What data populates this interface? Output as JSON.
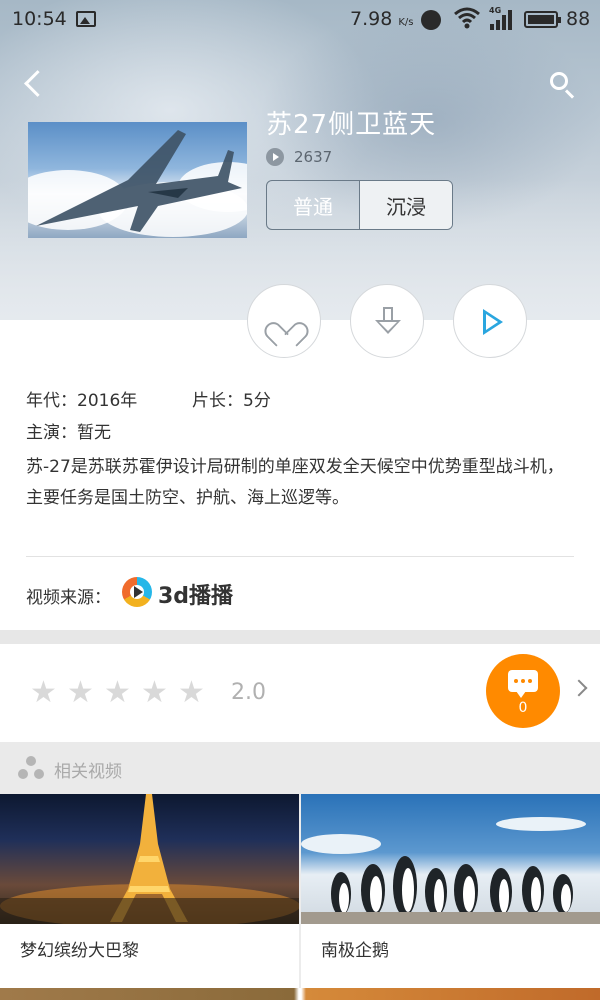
{
  "status_bar": {
    "time": "10:54",
    "net_speed": "7.98",
    "net_speed_unit": "K/s",
    "network_type": "4G",
    "battery": "88"
  },
  "header": {
    "back_icon": "chevron-left-icon",
    "search_icon": "search-icon"
  },
  "video": {
    "title": "苏27侧卫蓝天",
    "play_count": "2637",
    "modes": [
      "普通",
      "沉浸"
    ],
    "selected_mode": "沉浸"
  },
  "actions": {
    "like_icon": "heart-icon",
    "download_icon": "download-icon",
    "play_icon": "play-icon",
    "play_color": "#2aa6df"
  },
  "info": {
    "year": "年代：2016年",
    "duration": "片长：5分",
    "cast": "主演：暂无",
    "description": "苏-27是苏联苏霍伊设计局研制的单座双发全天候空中优势重型战斗机，主要任务是国土防空、护航、海上巡逻等。"
  },
  "source": {
    "label": "视频来源：",
    "name": "3d播播"
  },
  "rating": {
    "stars_filled": 0,
    "stars_total": 5,
    "value": "2.0",
    "comment_count": "0",
    "comment_color": "#ff8a00"
  },
  "related": {
    "title": "相关视频",
    "items": [
      {
        "label": "梦幻缤纷大巴黎"
      },
      {
        "label": "南极企鹅"
      }
    ]
  }
}
